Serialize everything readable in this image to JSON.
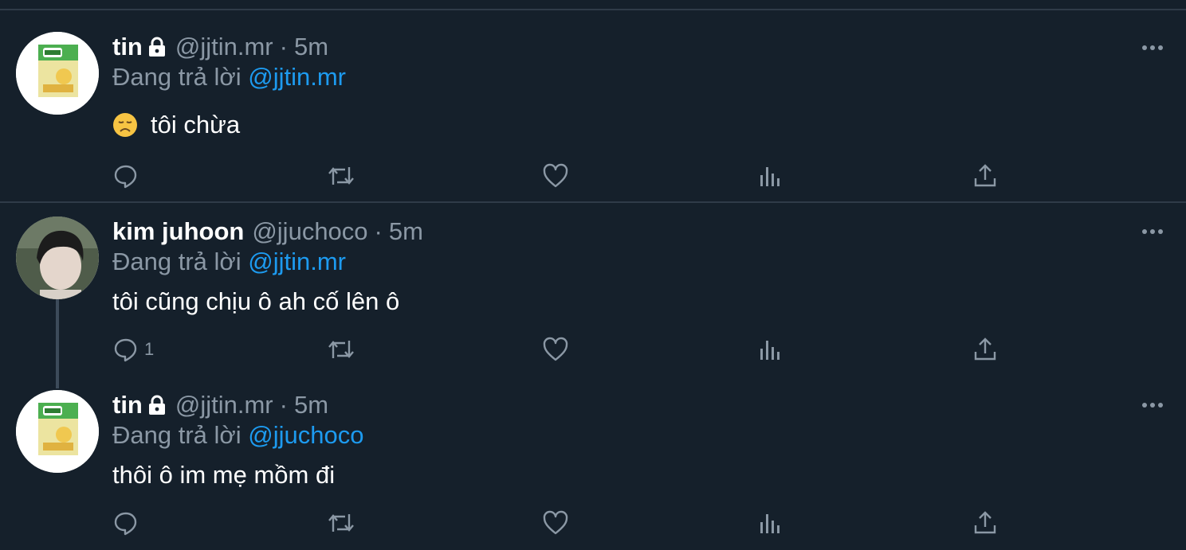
{
  "colors": {
    "background": "#15202b",
    "text": "#ffffff",
    "muted": "#8b98a5",
    "link": "#1d9bf0",
    "divider": "#2f3b48"
  },
  "reply_prefix": "Đang trả lời",
  "tweets": [
    {
      "display_name": "tin",
      "locked": true,
      "handle": "@jjtin.mr",
      "separator": "·",
      "time": "5m",
      "reply_to": "@jjtin.mr",
      "emoji": "😞",
      "text": "tôi chừa",
      "reply_count": ""
    },
    {
      "display_name": "kim juhoon",
      "locked": false,
      "handle": "@jjuchoco",
      "separator": "·",
      "time": "5m",
      "reply_to": "@jjtin.mr",
      "text": "tôi cũng chịu ô ah cố lên ô",
      "reply_count": "1"
    },
    {
      "display_name": "tin",
      "locked": true,
      "handle": "@jjtin.mr",
      "separator": "·",
      "time": "5m",
      "reply_to": "@jjuchoco",
      "text": "thôi ô im mẹ mồm đi",
      "reply_count": ""
    }
  ],
  "icons": [
    "lock-icon",
    "more-icon",
    "reply-icon",
    "retweet-icon",
    "like-icon",
    "analytics-icon",
    "share-icon"
  ]
}
